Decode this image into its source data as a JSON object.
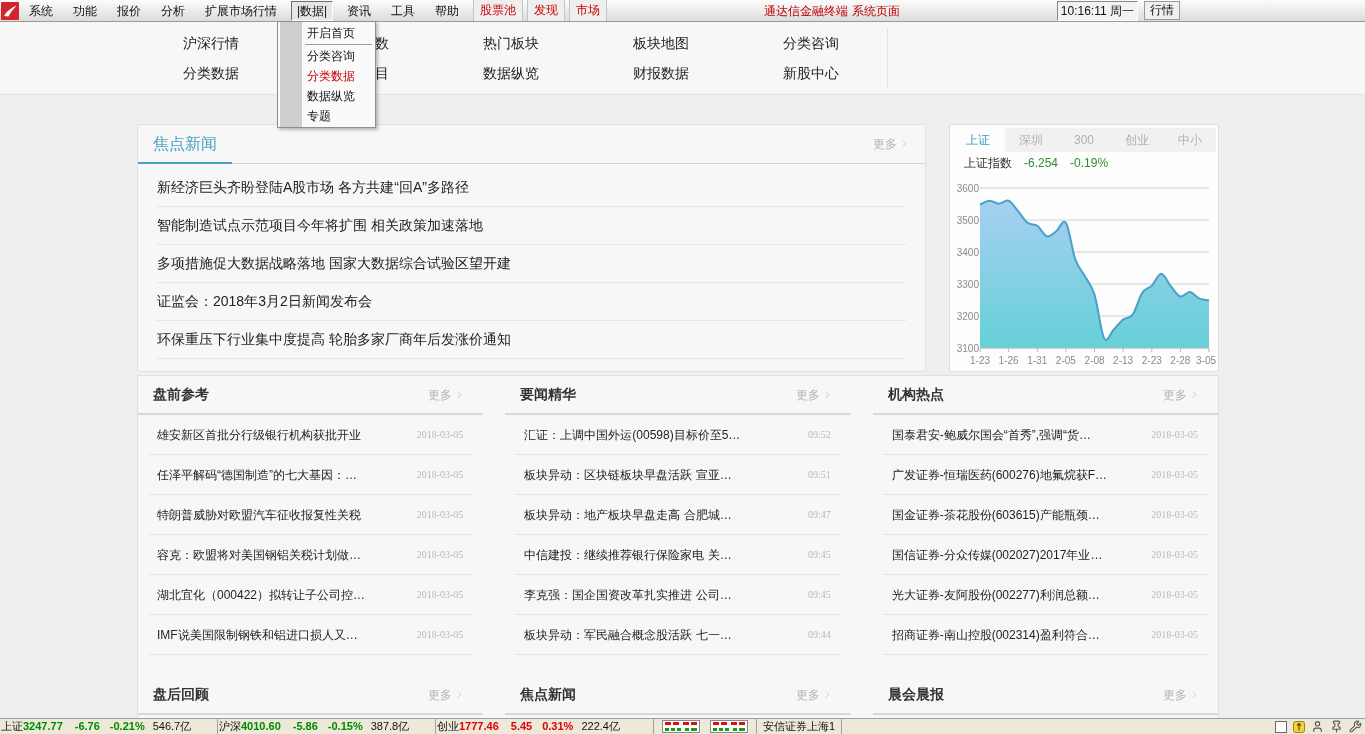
{
  "menu_bar": {
    "items": [
      {
        "label": "系统",
        "kind": "plain",
        "selected": false
      },
      {
        "label": "功能",
        "kind": "plain",
        "selected": false
      },
      {
        "label": "报价",
        "kind": "plain",
        "selected": false
      },
      {
        "label": "分析",
        "kind": "plain",
        "selected": false
      },
      {
        "label": "扩展市场行情",
        "kind": "plain",
        "selected": false
      },
      {
        "label": "|数据|",
        "kind": "plain",
        "selected": true
      },
      {
        "label": "资讯",
        "kind": "plain",
        "selected": false
      },
      {
        "label": "工具",
        "kind": "plain",
        "selected": false
      },
      {
        "label": "帮助",
        "kind": "plain",
        "selected": false
      },
      {
        "label": "股票池",
        "kind": "highlight",
        "selected": false
      },
      {
        "label": "发现",
        "kind": "highlight",
        "selected": false
      },
      {
        "label": "市场",
        "kind": "highlight",
        "selected": false
      }
    ],
    "title": "通达信金融终端 系统页面",
    "clock": "10:16:11 周一",
    "button": "行情"
  },
  "dropdown": {
    "items": [
      {
        "kind": "item",
        "label": "开启首页",
        "selected": false
      },
      {
        "kind": "separator"
      },
      {
        "kind": "item",
        "label": "分类咨询",
        "selected": false
      },
      {
        "kind": "item",
        "label": "分类数据",
        "selected": true
      },
      {
        "kind": "item",
        "label": "数据纵览",
        "selected": false
      },
      {
        "kind": "item",
        "label": "专题",
        "selected": false
      }
    ]
  },
  "nav": {
    "items": [
      "沪深行情",
      "数",
      "热门板块",
      "板块地图",
      "分类咨询",
      "分类数据",
      "目",
      "数据纵览",
      "财报数据",
      "新股中心"
    ]
  },
  "focus_news": {
    "title": "焦点新闻",
    "more": "更多",
    "items": [
      "新经济巨头齐盼登陆A股市场 各方共建“回A”多路径",
      "智能制造试点示范项目今年将扩围 相关政策加速落地",
      "多项措施促大数据战略落地 国家大数据综合试验区望开建",
      "证监会：2018年3月2日新闻发布会",
      "环保重压下行业集中度提高 轮胎多家厂商年后发涨价通知"
    ]
  },
  "index_panel": {
    "tabs": [
      {
        "label": "上证",
        "selected": true
      },
      {
        "label": "深圳",
        "selected": false
      },
      {
        "label": "300",
        "selected": false
      },
      {
        "label": "创业",
        "selected": false
      },
      {
        "label": "中小",
        "selected": false
      }
    ],
    "name": "上证指数",
    "change": "-6.254",
    "percent": "-0.19%",
    "rising": false,
    "chart_data": {
      "type": "area",
      "categories": [
        "1-23",
        null,
        null,
        "1-26",
        null,
        null,
        "1-31",
        null,
        null,
        "2-05",
        null,
        null,
        "2-08",
        null,
        null,
        "2-13",
        null,
        null,
        "2-23",
        null,
        null,
        "2-28",
        null,
        null,
        "3-05"
      ],
      "series": [
        {
          "color": "#4a9fcb",
          "values": [
            3548,
            3560,
            3551,
            3560,
            3527,
            3491,
            3482,
            3449,
            3465,
            3491,
            3376,
            3324,
            3267,
            3131,
            3157,
            3189,
            3204,
            3272,
            3295,
            3332,
            3293,
            3261,
            3275,
            3254,
            3249
          ]
        }
      ],
      "ylim": [
        3100,
        3600
      ],
      "yticks": [
        3100,
        3200,
        3300,
        3400,
        3500,
        3600
      ],
      "grid": true
    }
  },
  "sections": [
    {
      "title": "盘前参考",
      "more": "更多",
      "items": [
        {
          "text": "雄安新区首批分行级银行机构获批开业",
          "time": "2018-03-05"
        },
        {
          "text": "任泽平解码“德国制造”的七大基因：…",
          "time": "2018-03-05"
        },
        {
          "text": "特朗普威胁对欧盟汽车征收报复性关税",
          "time": "2018-03-05"
        },
        {
          "text": "容克：欧盟将对美国钢铝关税计划做…",
          "time": "2018-03-05"
        },
        {
          "text": "湖北宜化（000422）拟转让子公司控…",
          "time": "2018-03-05"
        },
        {
          "text": "IMF说美国限制钢铁和铝进口损人又…",
          "time": "2018-03-05"
        }
      ]
    },
    {
      "title": "要闻精华",
      "more": "更多",
      "items": [
        {
          "text": "汇证：上调中国外运(00598)目标价至5…",
          "time": "09:52"
        },
        {
          "text": "板块异动：区块链板块早盘活跃 宣亚…",
          "time": "09:51"
        },
        {
          "text": "板块异动：地产板块早盘走高 合肥城…",
          "time": "09:47"
        },
        {
          "text": "中信建投：继续推荐银行保险家电 关…",
          "time": "09:45"
        },
        {
          "text": "李克强：国企国资改革扎实推进 公司…",
          "time": "09:45"
        },
        {
          "text": "板块异动：军民融合概念股活跃 七一…",
          "time": "09:44"
        }
      ]
    },
    {
      "title": "机构热点",
      "more": "更多",
      "items": [
        {
          "text": "国泰君安-鲍威尔国会“首秀”,强调“货…",
          "time": "2018-03-05"
        },
        {
          "text": "广发证券-恒瑞医药(600276)地氟烷获F…",
          "time": "2018-03-05"
        },
        {
          "text": "国金证券-茶花股份(603615)产能瓶颈…",
          "time": "2018-03-05"
        },
        {
          "text": "国信证券-分众传媒(002027)2017年业…",
          "time": "2018-03-05"
        },
        {
          "text": "光大证券-友阿股份(002277)利润总额…",
          "time": "2018-03-05"
        },
        {
          "text": "招商证券-南山控股(002314)盈利符合…",
          "time": "2018-03-05"
        }
      ]
    },
    {
      "title": "盘后回顾",
      "more": "更多"
    },
    {
      "title": "焦点新闻",
      "more": "更多"
    },
    {
      "title": "晨会晨报",
      "more": "更多"
    }
  ],
  "status_bar": {
    "quotes": [
      {
        "name": "上证",
        "value": "3247.77",
        "change": "-6.76",
        "percent": "-0.21%",
        "volume": "546.7亿",
        "rising": false
      },
      {
        "name": "沪深",
        "value": "4010.60",
        "change": "-5.86",
        "percent": "-0.15%",
        "volume": "387.8亿",
        "rising": false
      },
      {
        "name": "创业",
        "value": "1777.46",
        "change": "5.45",
        "percent": "0.31%",
        "volume": "222.4亿",
        "rising": true
      }
    ],
    "broker": "安信证券上海1"
  }
}
